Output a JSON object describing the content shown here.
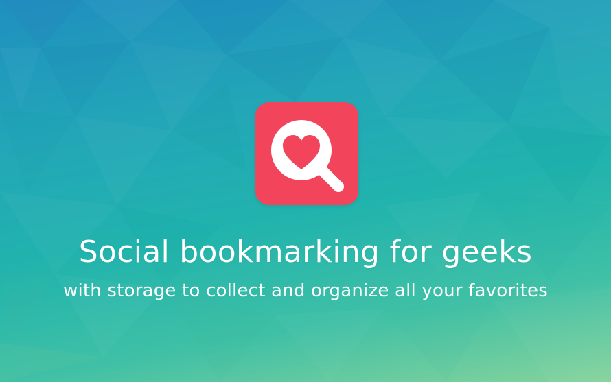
{
  "hero": {
    "title": "Social bookmarking for geeks",
    "subtitle": "with storage to collect and organize all your favorites"
  },
  "logo": {
    "icon": "heart-magnifier-icon",
    "background_color": "#f2445b",
    "heart_color": "#f2445b"
  },
  "colors": {
    "gradient_top": "#1f8fbf",
    "gradient_middle": "#21b3ad",
    "gradient_bottom": "#86d39b",
    "text": "#ffffff"
  }
}
